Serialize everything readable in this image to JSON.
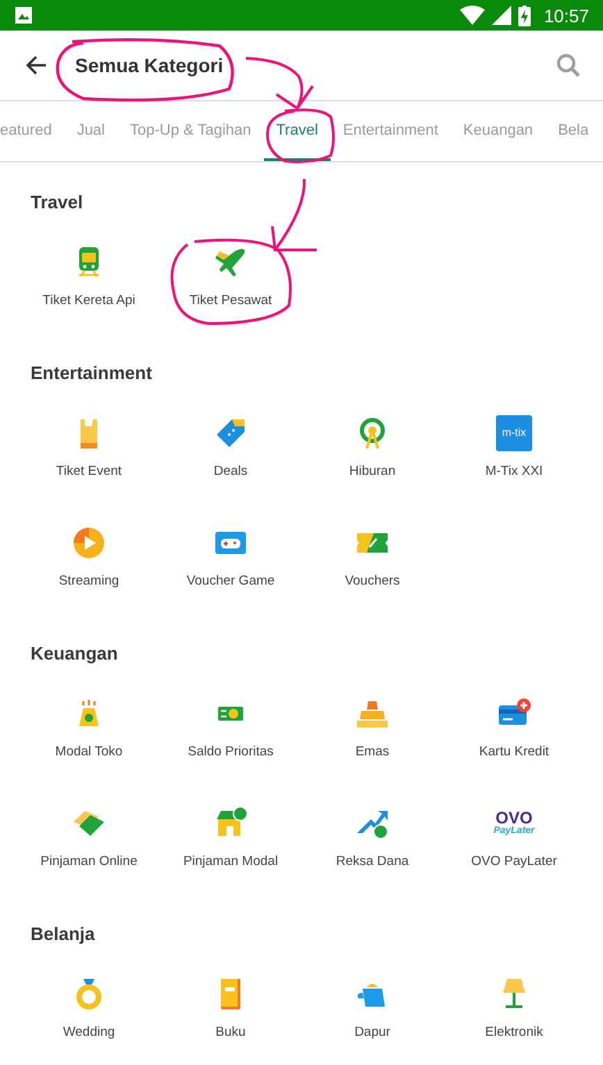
{
  "status_bar": {
    "time": "10:57"
  },
  "header": {
    "title": "Semua Kategori"
  },
  "tabs": [
    {
      "label": "eatured",
      "selected": false
    },
    {
      "label": "Jual",
      "selected": false
    },
    {
      "label": "Top-Up & Tagihan",
      "selected": false
    },
    {
      "label": "Travel",
      "selected": true
    },
    {
      "label": "Entertainment",
      "selected": false
    },
    {
      "label": "Keuangan",
      "selected": false
    },
    {
      "label": "Bela",
      "selected": false
    }
  ],
  "sections": [
    {
      "title": "Travel",
      "items": [
        {
          "label": "Tiket Kereta Api"
        },
        {
          "label": "Tiket Pesawat"
        }
      ]
    },
    {
      "title": "Entertainment",
      "items": [
        {
          "label": "Tiket Event"
        },
        {
          "label": "Deals"
        },
        {
          "label": "Hiburan"
        },
        {
          "label": "M-Tix XXI",
          "logo": [
            "m-tix"
          ]
        },
        {
          "label": "Streaming"
        },
        {
          "label": "Voucher Game"
        },
        {
          "label": "Vouchers"
        }
      ]
    },
    {
      "title": "Keuangan",
      "items": [
        {
          "label": "Modal Toko"
        },
        {
          "label": "Saldo Prioritas"
        },
        {
          "label": "Emas"
        },
        {
          "label": "Kartu Kredit"
        },
        {
          "label": "Pinjaman Online"
        },
        {
          "label": "Pinjaman Modal"
        },
        {
          "label": "Reksa Dana"
        },
        {
          "label": "OVO PayLater",
          "logo": [
            "OVO",
            "PayLater"
          ]
        }
      ]
    },
    {
      "title": "Belanja",
      "items": [
        {
          "label": "Wedding"
        },
        {
          "label": "Buku"
        },
        {
          "label": "Dapur"
        },
        {
          "label": "Elektronik"
        }
      ]
    }
  ]
}
